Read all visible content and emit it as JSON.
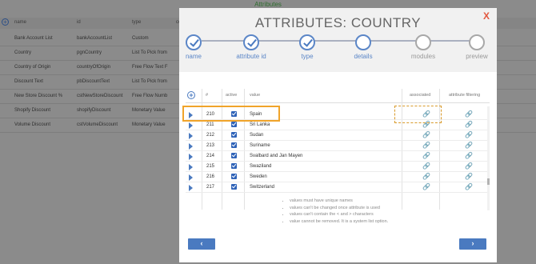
{
  "background": {
    "title": "Attributes",
    "headers": [
      "name",
      "id",
      "type",
      "co"
    ],
    "rows": [
      [
        "Bank Account List",
        "bankAccountList",
        "Custom"
      ],
      [
        "Country",
        "pgnCountry",
        "List To Pick from"
      ],
      [
        "Country of Origin",
        "countryOfOrigin",
        "Free Flow Text F"
      ],
      [
        "Discount Text",
        "pbDiscountText",
        "List To Pick from"
      ],
      [
        "New Store Discount %",
        "cstNewStoreDiscount",
        "Free Flow Numb"
      ],
      [
        "Shopify Discount",
        "shopifyDiscount",
        "Monetary Value"
      ],
      [
        "Volume Discount",
        "cstVolumeDiscount",
        "Monetary Value"
      ]
    ]
  },
  "modal": {
    "title": "ATTRIBUTES:   COUNTRY",
    "close_label": "X",
    "steps": [
      {
        "label": "name",
        "state": "done"
      },
      {
        "label": "attribute id",
        "state": "done"
      },
      {
        "label": "type",
        "state": "done"
      },
      {
        "label": "details",
        "state": "current"
      },
      {
        "label": "modules",
        "state": "future"
      },
      {
        "label": "preview",
        "state": "future"
      }
    ],
    "table": {
      "headers": {
        "num": "#",
        "active": "active",
        "value": "value",
        "associated": "associated",
        "filtering": "attribute filtering"
      },
      "rows": [
        {
          "num": "210",
          "value": "Spain"
        },
        {
          "num": "211",
          "value": "Sri Lanka"
        },
        {
          "num": "212",
          "value": "Sudan"
        },
        {
          "num": "213",
          "value": "Suriname"
        },
        {
          "num": "214",
          "value": "Svalbard and Jan Mayen"
        },
        {
          "num": "215",
          "value": "Swaziland"
        },
        {
          "num": "216",
          "value": "Sweden"
        },
        {
          "num": "217",
          "value": "Switzerland"
        }
      ]
    },
    "notes": [
      "values must have unique names",
      "values can't be changed once attribute is used",
      "values can't contain the < and > characters",
      "value cannot be removed. It is a system list option."
    ],
    "prev_label": "‹",
    "next_label": "›"
  },
  "colors": {
    "accent": "#4a7ac0",
    "highlight": "#f0a42a",
    "close": "#e2583f"
  }
}
